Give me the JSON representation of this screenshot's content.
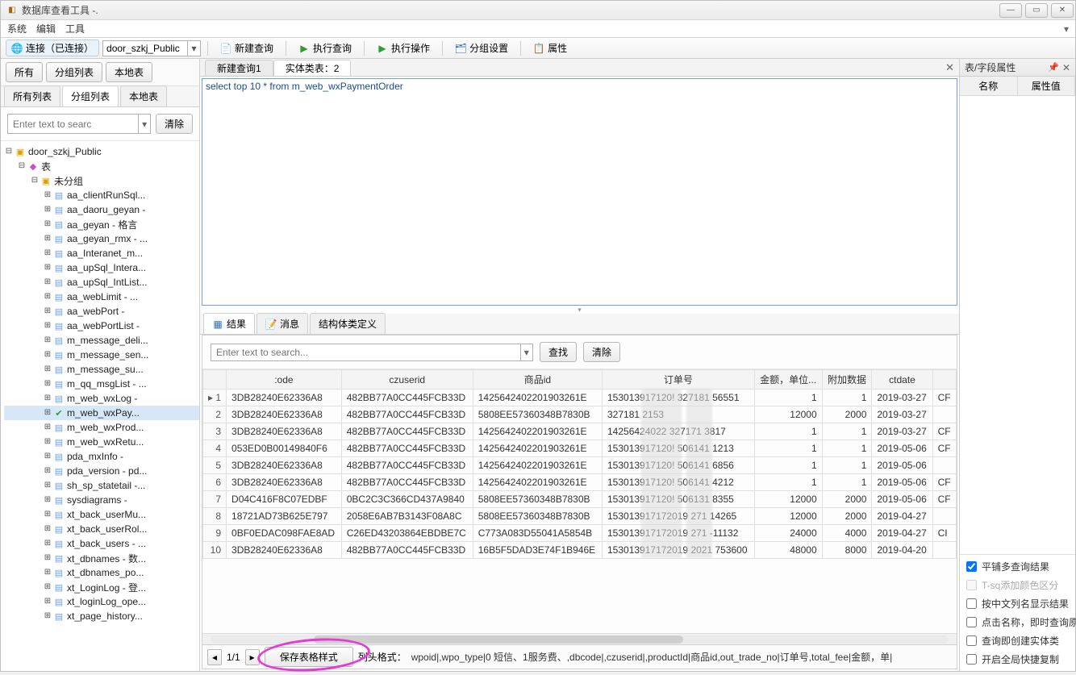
{
  "window": {
    "title": "数据库查看工具 -."
  },
  "menu": {
    "system": "系统",
    "edit": "编辑",
    "tool": "工具"
  },
  "toolbar": {
    "connect_label": "连接（已连接）",
    "db_value": "door_szkj_Public",
    "new_query": "新建查询",
    "exec_query": "执行查询",
    "exec_op": "执行操作",
    "group_set": "分组设置",
    "props": "属性"
  },
  "left": {
    "tabs_top": {
      "all": "所有",
      "group": "分组列表",
      "local": "本地表"
    },
    "tabs_sec": {
      "all": "所有列表",
      "group": "分组列表",
      "local": "本地表"
    },
    "search_placeholder": "Enter text to searc",
    "clear": "清除",
    "root": "door_szkj_Public",
    "tables": "表",
    "ungrouped": "未分组",
    "items": [
      "aa_clientRunSql...",
      "aa_daoru_geyan -",
      "aa_geyan - 格言",
      "aa_geyan_rmx - ...",
      "aa_Interanet_m...",
      "aa_upSql_Intera...",
      "aa_upSql_IntList...",
      "aa_webLimit - ...",
      "aa_webPort -",
      "aa_webPortList -",
      "m_message_deli...",
      "m_message_sen...",
      "m_message_su...",
      "m_qq_msgList - ...",
      "m_web_wxLog -",
      "m_web_wxPay...",
      "m_web_wxProd...",
      "m_web_wxRetu...",
      "pda_mxInfo -",
      "pda_version - pd...",
      "sh_sp_statetail -...",
      "sysdiagrams -",
      "xt_back_userMu...",
      "xt_back_userRol...",
      "xt_back_users - ...",
      "xt_dbnames - 数...",
      "xt_dbnames_po...",
      "xt_LoginLog - 登...",
      "xt_loginLog_ope...",
      "xt_page_history..."
    ],
    "selected_index": 15
  },
  "center": {
    "tabs": {
      "tab1": "新建查询1",
      "tab2": "实体类表：2"
    },
    "sql": "select top 10 * from m_web_wxPaymentOrder",
    "result_tabs": {
      "result": "结果",
      "message": "消息",
      "struct": "结构体类定义"
    },
    "search_placeholder": "Enter text to search...",
    "find": "查找",
    "clear": "清除",
    "columns": [
      "",
      ":ode",
      "czuserid",
      "商品id",
      "订单号",
      "金额，单位...",
      "附加数据",
      "ctdate",
      ""
    ],
    "rows": [
      {
        "n": "1",
        "c": [
          "3DB28240E62336A8",
          "482BB77A0CC445FCB33D",
          "1425642402201903261E",
          "153013917120!",
          "327181",
          "56551",
          "1",
          "1",
          "2019-03-27",
          "CF"
        ]
      },
      {
        "n": "2",
        "c": [
          "3DB28240E62336A8",
          "482BB77A0CC445FCB33D",
          "5808EE57360348B7830B",
          "",
          "327181",
          "2153",
          "12000",
          "2000",
          "2019-03-27",
          ""
        ]
      },
      {
        "n": "3",
        "c": [
          "3DB28240E62336A8",
          "482BB77A0CC445FCB33D",
          "1425642402201903261E",
          "14256424022",
          "327171",
          "3817",
          "1",
          "1",
          "2019-03-27",
          "CF"
        ]
      },
      {
        "n": "4",
        "c": [
          "053ED0B00149840F6",
          "482BB77A0CC445FCB33D",
          "1425642402201903261E",
          "153013917120!",
          "506141",
          "1213",
          "1",
          "1",
          "2019-05-06",
          "CF"
        ]
      },
      {
        "n": "5",
        "c": [
          "3DB28240E62336A8",
          "482BB77A0CC445FCB33D",
          "1425642402201903261E",
          "153013917120!",
          "506141",
          "6856",
          "1",
          "1",
          "2019-05-06",
          ""
        ]
      },
      {
        "n": "6",
        "c": [
          "3DB28240E62336A8",
          "482BB77A0CC445FCB33D",
          "1425642402201903261E",
          "153013917120!",
          "506141",
          "4212",
          "1",
          "1",
          "2019-05-06",
          "CF"
        ]
      },
      {
        "n": "7",
        "c": [
          "D04C416F8C07EDBF",
          "0BC2C3C366CD437A9840",
          "5808EE57360348B7830B",
          "153013917120!",
          "506131",
          "8355",
          "12000",
          "2000",
          "2019-05-06",
          "CF"
        ]
      },
      {
        "n": "8",
        "c": [
          "18721AD73B625E797",
          "2058E6AB7B3143F08A8C",
          "5808EE57360348B7830B",
          "153013917172019",
          "271",
          "14265",
          "12000",
          "2000",
          "2019-04-27",
          ""
        ]
      },
      {
        "n": "9",
        "c": [
          "0BF0EDAC098FAE8AD",
          "C26ED43203864EBDBE7C",
          "C773A083D55041A5854B",
          "153013917172019",
          "271",
          "-11132",
          "24000",
          "4000",
          "2019-04-27",
          "CI"
        ]
      },
      {
        "n": "10",
        "c": [
          "3DB28240E62336A8",
          "482BB77A0CC445FCB33D",
          "16B5F5DAD3E74F1B946E",
          "153013917172019",
          "2021",
          "753600",
          "48000",
          "8000",
          "2019-04-20",
          ""
        ]
      }
    ],
    "page": "1/1",
    "save_fmt": "保存表格样式",
    "col_fmt_label": "列头格式：",
    "col_fmt": "wpoid|,wpo_type|0 短信、1服务费、,dbcode|,czuserid|,productId|商品id,out_trade_no|订单号,total_fee|金额，单|"
  },
  "right": {
    "title": "表/字段属性",
    "col_name": "名称",
    "col_val": "属性值",
    "checks": {
      "flat": "平铺多查询结果",
      "tsql": "T-sq添加颜色区分",
      "cn_col": "按中文列名显示结果",
      "click_name": "点击名称，即时查询原",
      "query_create": "查询即创建实体类",
      "global_copy": "开启全局快捷复制"
    }
  }
}
